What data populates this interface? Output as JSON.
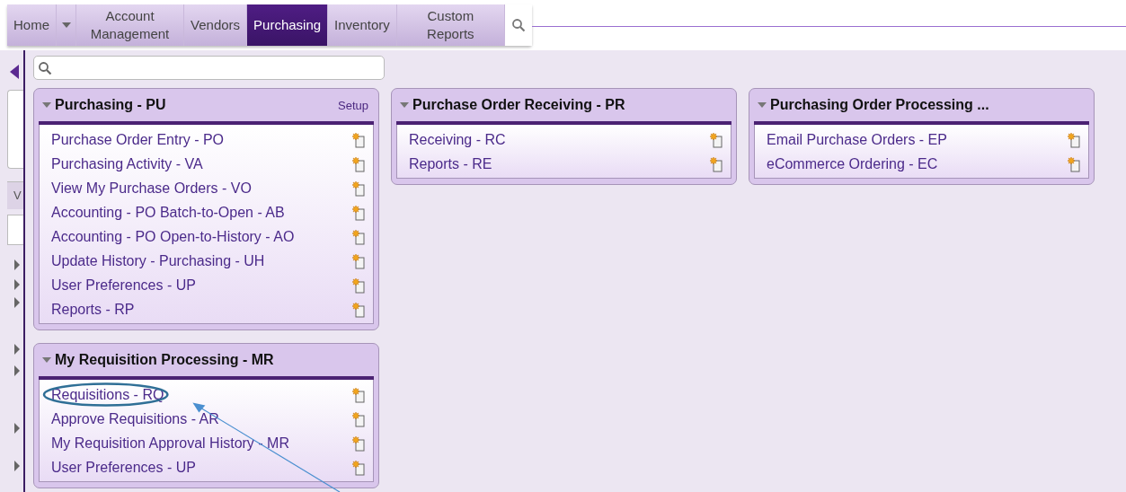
{
  "nav_tabs": [
    {
      "label": "Home",
      "selected": false
    },
    {
      "label": "Account Management",
      "selected": false
    },
    {
      "label": "Vendors",
      "selected": false
    },
    {
      "label": "Purchasing",
      "selected": true
    },
    {
      "label": "Inventory",
      "selected": false
    },
    {
      "label": "Custom Reports",
      "selected": false
    }
  ],
  "sidebar": {
    "tab_label": "V"
  },
  "panels": [
    {
      "title": "Purchasing - PU",
      "action": "Setup",
      "expanded": true,
      "items": [
        "Purchase Order Entry - PO",
        "Purchasing Activity - VA",
        "View My Purchase Orders - VO",
        "Accounting - PO Batch-to-Open - AB",
        "Accounting - PO Open-to-History - AO",
        "Update History - Purchasing - UH",
        "User Preferences - UP",
        "Reports - RP"
      ]
    },
    {
      "title": "Purchase Order Receiving - PR",
      "expanded": true,
      "items": [
        "Receiving - RC",
        "Reports - RE"
      ]
    },
    {
      "title": "Purchasing Order Processing ...",
      "expanded": true,
      "items": [
        "Email Purchase Orders - EP",
        "eCommerce Ordering - EC"
      ]
    },
    {
      "title": "My Requisition Processing - MR",
      "expanded": true,
      "items": [
        {
          "label": "Requisitions - RQ",
          "circled": true
        },
        {
          "label": "Approve Requisitions - AR",
          "circled": false
        },
        {
          "label": "My Requisition Approval History - MR",
          "circled": false
        },
        {
          "label": "User Preferences - UP",
          "circled": false
        }
      ]
    }
  ]
}
